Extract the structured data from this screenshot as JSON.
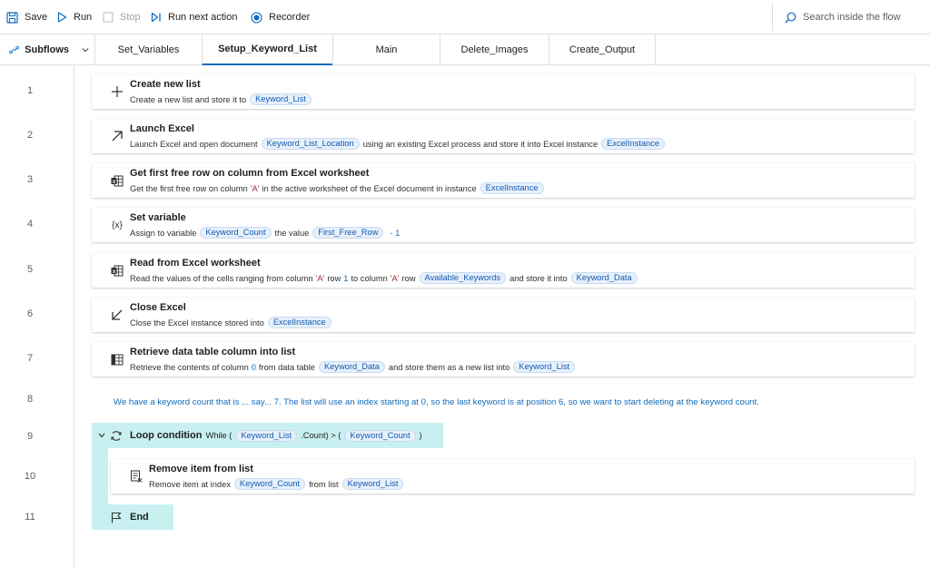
{
  "toolbar": {
    "save": "Save",
    "run": "Run",
    "stop": "Stop",
    "run_next": "Run next action",
    "recorder": "Recorder",
    "search_placeholder": "Search inside the flow"
  },
  "tabs": {
    "subflows": "Subflows",
    "items": [
      "Set_Variables",
      "Setup_Keyword_List",
      "Main",
      "Delete_Images",
      "Create_Output"
    ],
    "active": "Setup_Keyword_List"
  },
  "line_numbers": [
    "1",
    "2",
    "3",
    "4",
    "5",
    "6",
    "7",
    "8",
    "9",
    "10",
    "11"
  ],
  "actions": {
    "a1": {
      "icon": "plus-icon",
      "title": "Create new list",
      "text1": "Create a new list and store it to",
      "var1": "Keyword_List"
    },
    "a2": {
      "icon": "arrow-up-right-icon",
      "title": "Launch Excel",
      "text1": "Launch Excel and open document",
      "var1": "Keyword_List_Location",
      "text2": "using an existing Excel process and store it into Excel instance",
      "var2": "ExcelInstance"
    },
    "a3": {
      "icon": "excel-icon",
      "title": "Get first free row on column from Excel worksheet",
      "text1": "Get the first free row on column",
      "q1": "'A'",
      "text2": "in the active worksheet of the Excel document in instance",
      "var1": "ExcelInstance"
    },
    "a4": {
      "icon": "variable-icon",
      "title": "Set variable",
      "text1": "Assign to variable",
      "var1": "Keyword_Count",
      "text2": "the value",
      "var2": "First_Free_Row",
      "op": "- 1"
    },
    "a5": {
      "icon": "excel-icon",
      "title": "Read from Excel worksheet",
      "text1": "Read the values of the cells ranging from column",
      "q1": "'A'",
      "t_row": "row",
      "n1": "1",
      "t_to": "to column",
      "q2": "'A'",
      "t_row2": "row",
      "var1": "Available_Keywords",
      "text2": "and store it into",
      "var2": "Keyword_Data"
    },
    "a6": {
      "icon": "arrow-down-left-icon",
      "title": "Close Excel",
      "text1": "Close the Excel instance stored into",
      "var1": "ExcelInstance"
    },
    "a7": {
      "icon": "data-table-icon",
      "title": "Retrieve data table column into list",
      "text1": "Retrieve the contents of column",
      "n1": "0",
      "text2": "from data table",
      "var1": "Keyword_Data",
      "text3": "and store them as a new list into",
      "var2": "Keyword_List"
    },
    "comment": "We have a keyword count that is ... say... 7. The list will use an index starting at 0, so the last keyword is at position 6, so we want to start deleting at the keyword count.",
    "loop": {
      "title": "Loop condition",
      "text1": "While (",
      "var1": "Keyword_List",
      "text2": ".Count) > (",
      "var2": "Keyword_Count",
      "text3": ")"
    },
    "a10": {
      "icon": "remove-list-item-icon",
      "title": "Remove item from list",
      "text1": "Remove item at index",
      "var1": "Keyword_Count",
      "text2": "from list",
      "var2": "Keyword_List"
    },
    "end": "End"
  }
}
